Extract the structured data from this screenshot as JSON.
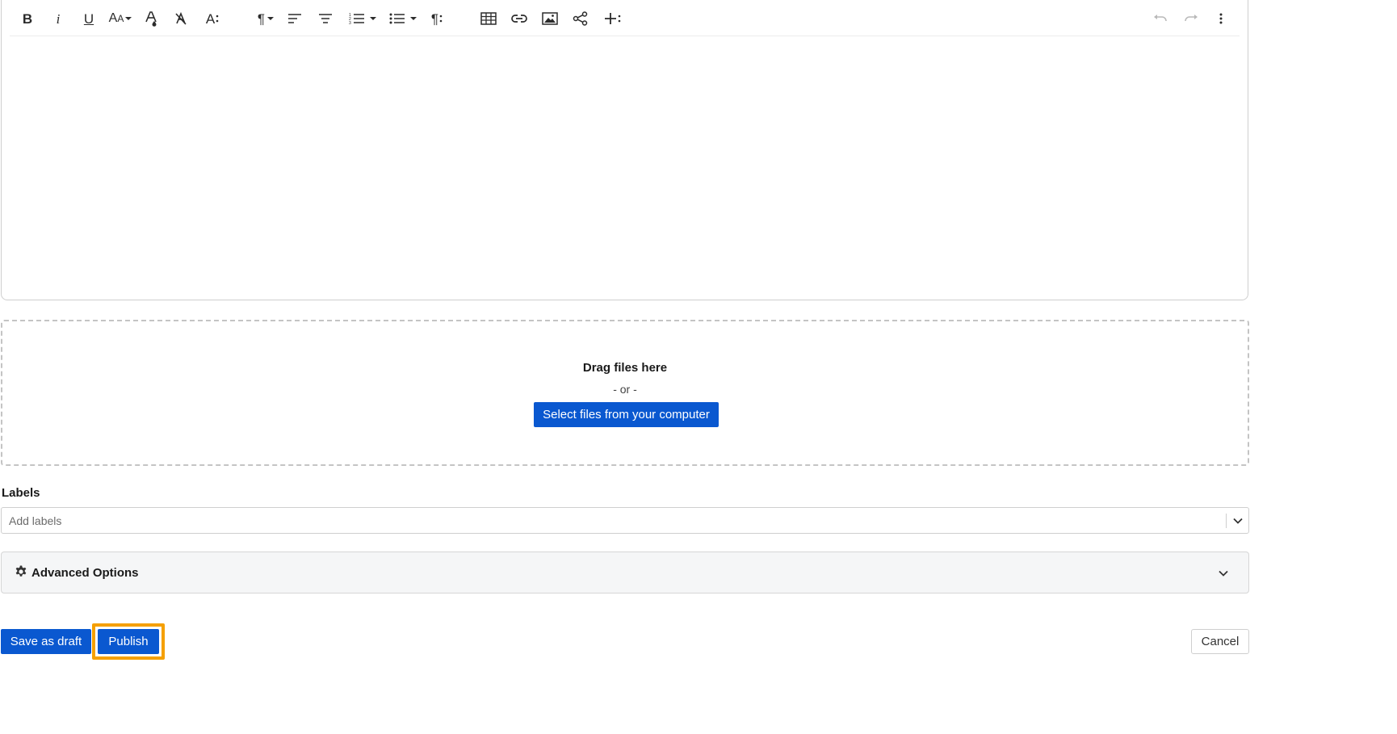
{
  "toolbar": {
    "items": [
      {
        "name": "bold-icon",
        "glyph": "B"
      },
      {
        "name": "italic-icon",
        "glyph": "i"
      },
      {
        "name": "underline-icon",
        "glyph": "U"
      },
      {
        "name": "font-size-icon",
        "glyph": "AA"
      },
      {
        "name": "text-color-icon",
        "glyph": "A"
      },
      {
        "name": "clear-formatting-icon",
        "glyph": "A"
      },
      {
        "name": "more-text-icon",
        "glyph": "A:"
      },
      {
        "name": "paragraph-format-icon",
        "glyph": "¶"
      },
      {
        "name": "align-left-icon"
      },
      {
        "name": "align-center-icon"
      },
      {
        "name": "ordered-list-icon"
      },
      {
        "name": "unordered-list-icon"
      },
      {
        "name": "more-paragraph-icon",
        "glyph": "¶:"
      },
      {
        "name": "table-icon"
      },
      {
        "name": "link-icon"
      },
      {
        "name": "image-icon"
      },
      {
        "name": "share-icon"
      },
      {
        "name": "more-insert-icon",
        "glyph": "+:"
      },
      {
        "name": "undo-icon"
      },
      {
        "name": "redo-icon"
      },
      {
        "name": "more-options-icon"
      }
    ]
  },
  "dropzone": {
    "title": "Drag files here",
    "or_text": "- or -",
    "select_button": "Select files from your computer"
  },
  "labels": {
    "title": "Labels",
    "placeholder": "Add labels"
  },
  "advanced": {
    "label": "Advanced Options",
    "icon": "gear-icon"
  },
  "footer": {
    "save_draft": "Save as draft",
    "publish": "Publish",
    "cancel": "Cancel"
  },
  "colors": {
    "primary": "#0a58d0",
    "focus_outline": "#f5a000"
  }
}
